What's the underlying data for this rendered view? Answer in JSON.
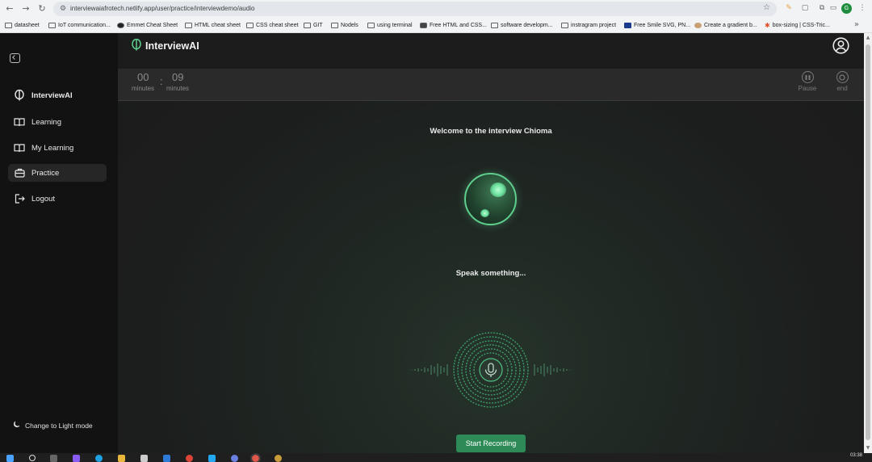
{
  "browser": {
    "url": "interviewaiafrotech.netlify.app/user/practice/interviewdemo/audio",
    "profile_initial": "G",
    "bookmarks": [
      "datasheet",
      "IoT communication...",
      "Emmet Cheat Sheet",
      "HTML cheat sheet",
      "CSS cheat sheet",
      "GIT",
      "Nodels",
      "using terminal",
      "Free HTML and CSS...",
      "software developm...",
      "instragram project",
      "Free Smile SVG, PN...",
      "Create a gradient b...",
      "box-sizing | CSS-Tric..."
    ],
    "more_label": "»"
  },
  "sidebar": {
    "brand": "InterviewAI",
    "items": [
      {
        "label": "Learning",
        "icon": "book-icon"
      },
      {
        "label": "My Learning",
        "icon": "book-open-icon"
      },
      {
        "label": "Practice",
        "icon": "briefcase-icon",
        "active": true
      },
      {
        "label": "Logout",
        "icon": "logout-icon"
      }
    ],
    "theme_toggle": "Change to Light mode"
  },
  "header": {
    "logo_text": "InterviewAI"
  },
  "timer": {
    "minutes_value": "00",
    "minutes_label": "minutes",
    "colon": ":",
    "seconds_value": "09",
    "seconds_label": "minutes",
    "pause_label": "Pause",
    "end_label": "end"
  },
  "interview": {
    "welcome": "Welcome to the interview Chioma",
    "status": "Speak something...",
    "record_button": "Start Recording"
  },
  "taskbar": {
    "time": "03:38"
  },
  "colors": {
    "accent": "#2e8b57",
    "orb_glow": "#5fcf8d",
    "sidebar_bg": "#121212"
  }
}
